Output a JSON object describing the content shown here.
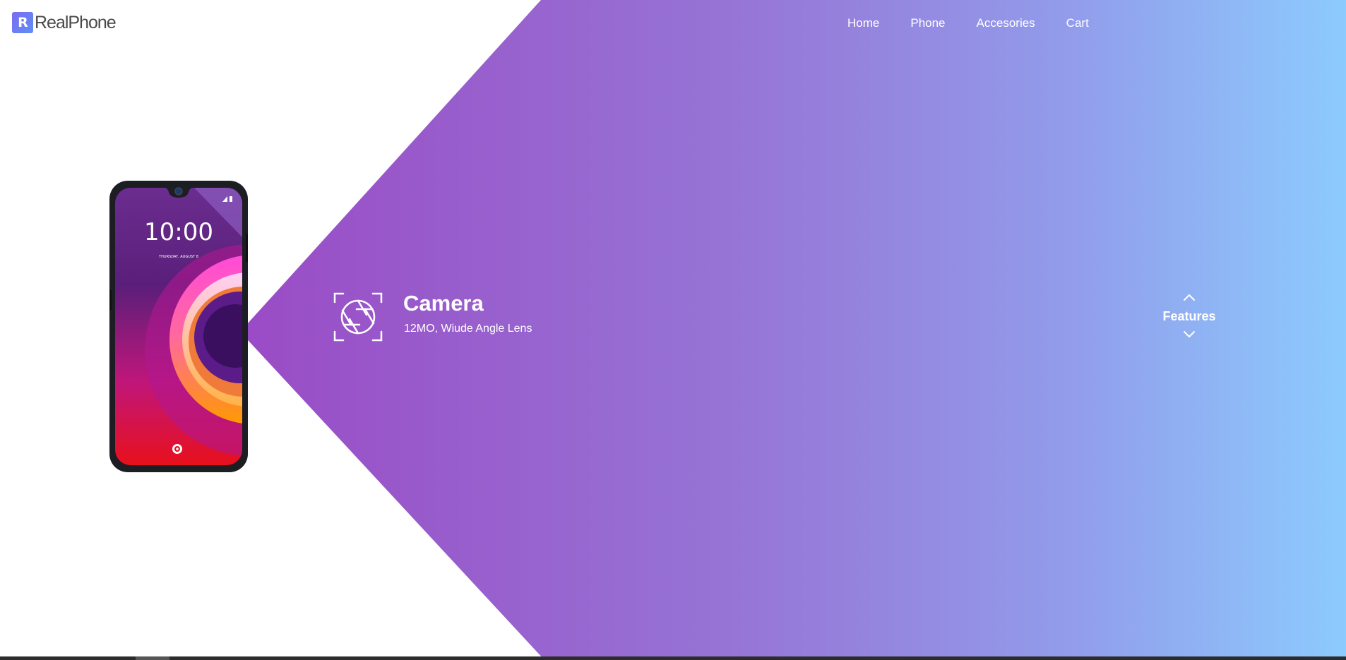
{
  "brand": {
    "name": "RealPhone",
    "logo_mark": "R"
  },
  "nav": {
    "items": [
      {
        "label": "Home"
      },
      {
        "label": "Phone"
      },
      {
        "label": "Accesories"
      },
      {
        "label": "Cart"
      }
    ]
  },
  "phone": {
    "clock": "10:00",
    "date": "THURSDAY, AUGUST 8"
  },
  "feature": {
    "icon": "camera-aperture-icon",
    "title": "Camera",
    "description": "12MO, Wiude Angle Lens"
  },
  "switcher": {
    "label": "Features",
    "up_icon": "chevron-up-icon",
    "down_icon": "chevron-down-icon"
  },
  "colors": {
    "gradient_start": "#9a4fc6",
    "gradient_end": "#8ccbfd",
    "text": "#ffffff"
  }
}
